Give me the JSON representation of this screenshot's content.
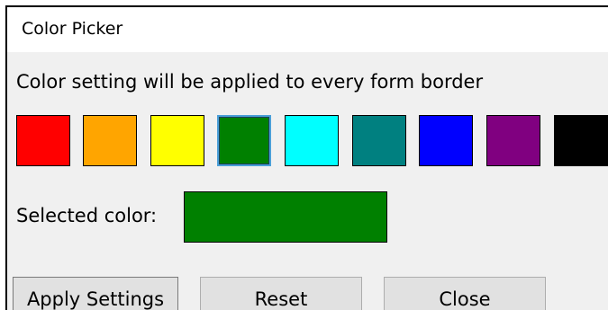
{
  "window": {
    "title": "Color Picker"
  },
  "description": "Color setting will be applied to every form border",
  "palette": [
    {
      "name": "red",
      "color": "#ff0000"
    },
    {
      "name": "orange",
      "color": "#ffa500"
    },
    {
      "name": "yellow",
      "color": "#ffff00"
    },
    {
      "name": "green",
      "color": "#008000",
      "selected": true
    },
    {
      "name": "cyan",
      "color": "#00ffff"
    },
    {
      "name": "teal",
      "color": "#008080"
    },
    {
      "name": "blue",
      "color": "#0000ff"
    },
    {
      "name": "purple",
      "color": "#800080"
    },
    {
      "name": "black",
      "color": "#000000"
    }
  ],
  "selected": {
    "label": "Selected color:",
    "color": "#008000"
  },
  "buttons": {
    "apply": "Apply Settings",
    "reset": "Reset",
    "close": "Close"
  }
}
